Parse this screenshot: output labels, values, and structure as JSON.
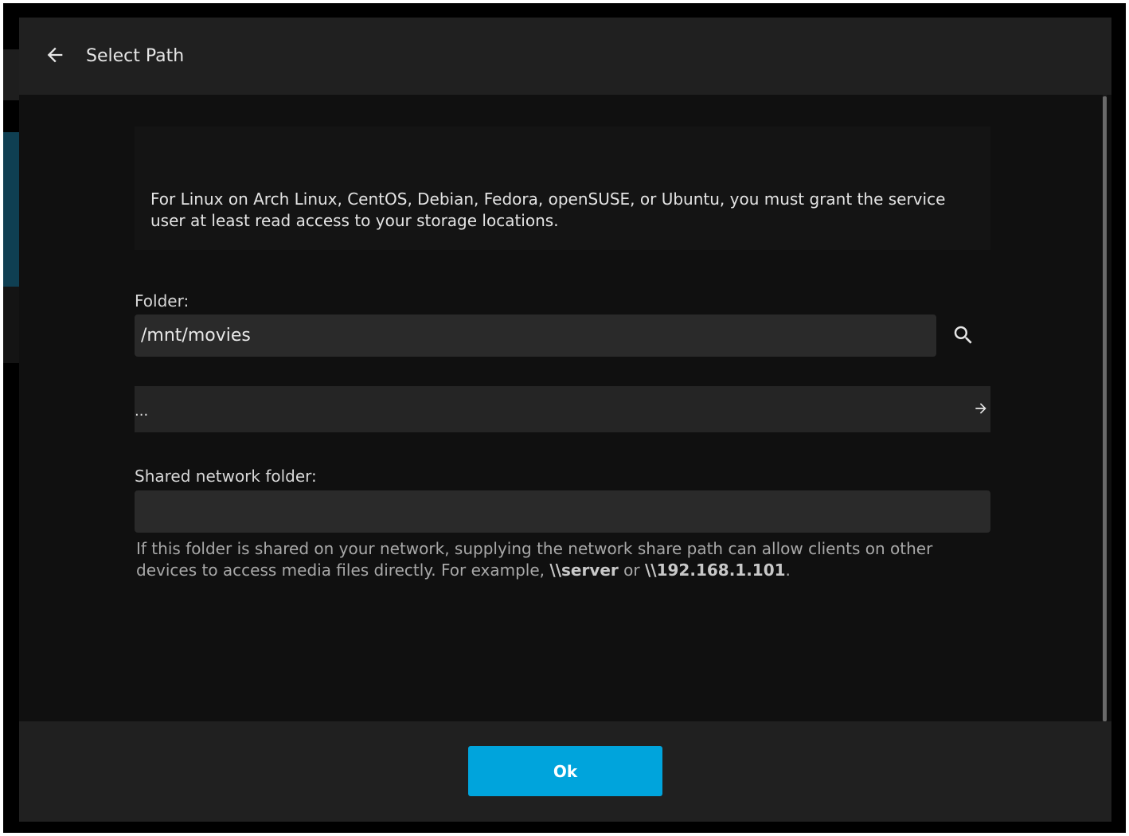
{
  "dialog": {
    "title": "Select Path",
    "back_icon": "arrow-left-icon"
  },
  "info": {
    "text": "For Linux on Arch Linux, CentOS, Debian, Fedora, openSUSE, or Ubuntu, you must grant the service user at least read access to your storage locations."
  },
  "folder": {
    "label": "Folder:",
    "value": "/mnt/movies",
    "search_icon": "search-icon"
  },
  "path_list": {
    "items": [
      {
        "label": "...",
        "icon": "arrow-right-icon"
      }
    ]
  },
  "network_share": {
    "label": "Shared network folder:",
    "value": "",
    "help_prefix": "If this folder is shared on your network, supplying the network share path can allow clients on other devices to access media files directly. For example, ",
    "example_1": "\\\\server",
    "help_or": " or ",
    "example_2": "\\\\192.168.1.101",
    "help_suffix": "."
  },
  "footer": {
    "ok_label": "Ok"
  },
  "colors": {
    "accent": "#00a4dc",
    "dialog_bg": "#101010",
    "header_bg": "#202020",
    "input_bg": "#2a2a2a"
  }
}
